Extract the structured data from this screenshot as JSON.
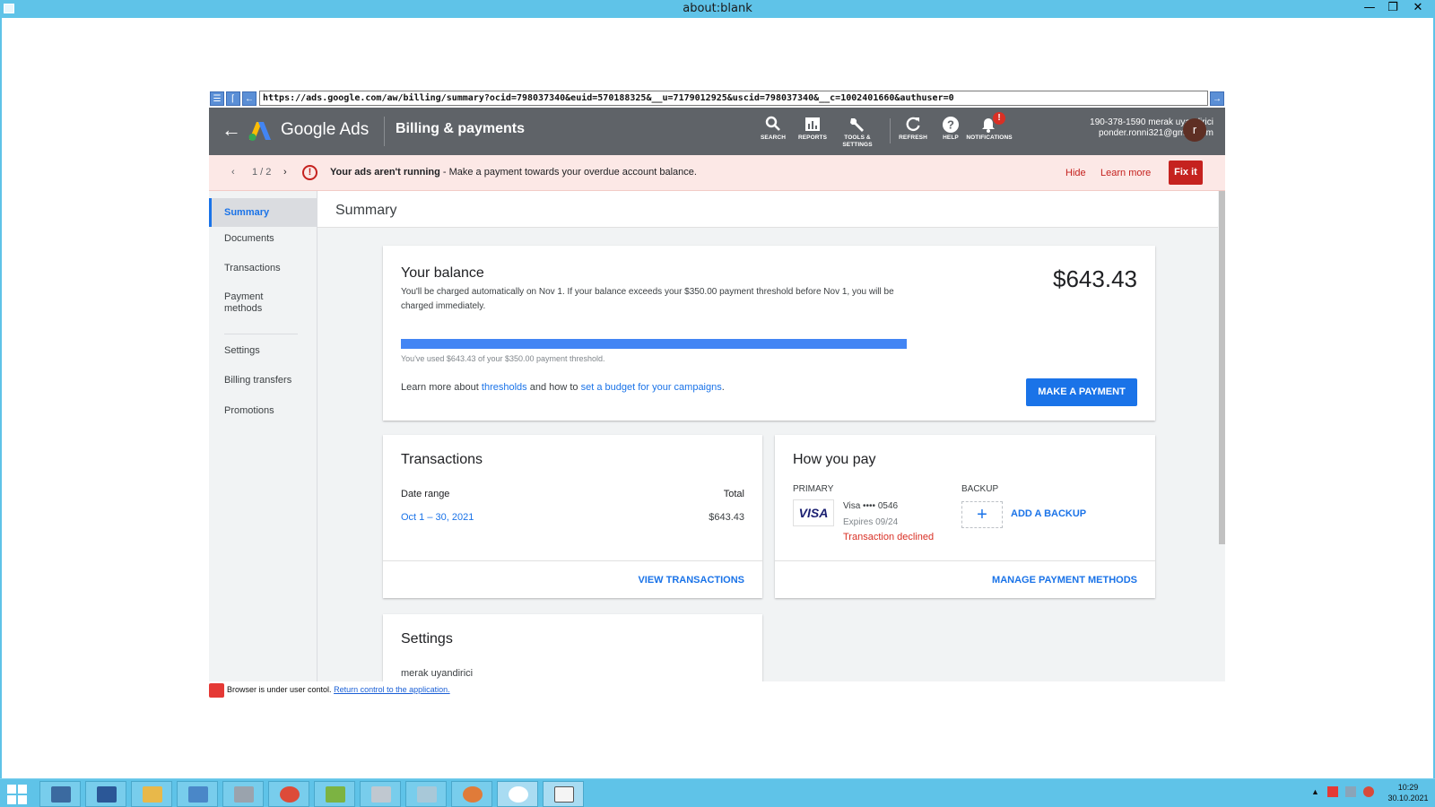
{
  "window": {
    "title": "about:blank"
  },
  "browser": {
    "url": "https://ads.google.com/aw/billing/summary?ocid=798037340&euid=570188325&__u=7179012925&uscid=798037340&__c=1002401660&authuser=0",
    "status_text": "Browser is under user contol.",
    "status_link": "Return control to the application."
  },
  "header": {
    "brand": "Google Ads",
    "page_title": "Billing & payments",
    "tools": [
      {
        "label": "SEARCH",
        "icon": "search-icon"
      },
      {
        "label": "REPORTS",
        "icon": "reports-icon"
      },
      {
        "label": "TOOLS &",
        "label2": "SETTINGS",
        "icon": "wrench-icon"
      },
      {
        "label": "REFRESH",
        "icon": "refresh-icon"
      },
      {
        "label": "HELP",
        "icon": "help-icon"
      },
      {
        "label": "NOTIFICATIONS",
        "icon": "bell-icon",
        "badge": "!"
      }
    ],
    "account_line1": "190-378-1590 merak uyandirici",
    "account_line2": "ponder.ronni321@gmail.com",
    "avatar_letter": "r"
  },
  "alert": {
    "pager": "1 / 2",
    "bold": "Your ads aren't running",
    "text": " - Make a payment towards your overdue account balance.",
    "hide": "Hide",
    "learn_more": "Learn more",
    "fix_it": "Fix it",
    "color": "#c5221f"
  },
  "sidebar": {
    "items": [
      "Summary",
      "Documents",
      "Transactions",
      "Payment methods",
      "Settings",
      "Billing transfers",
      "Promotions"
    ]
  },
  "main": {
    "heading": "Summary",
    "balance": {
      "title": "Your balance",
      "desc": "You'll be charged automatically on Nov 1. If your balance exceeds your $350.00 payment threshold before Nov 1, you will be charged immediately.",
      "amount": "$643.43",
      "progress_fraction": 1.0,
      "progress_note": "You've used $643.43 of your $350.00 payment threshold.",
      "learn_prefix": "Learn more about ",
      "thresholds": "thresholds",
      "learn_mid": " and how to ",
      "budget_link": "set a budget for your campaigns",
      "learn_suffix": ".",
      "make_payment": "MAKE A PAYMENT"
    },
    "transactions": {
      "title": "Transactions",
      "col_date": "Date range",
      "col_total": "Total",
      "date": "Oct 1 – 30, 2021",
      "total": "$643.43",
      "view": "VIEW TRANSACTIONS"
    },
    "how_you_pay": {
      "title": "How you pay",
      "primary": "PRIMARY",
      "card_brand": "VISA",
      "card_name": "Visa •••• 0546",
      "expires": "Expires 09/24",
      "declined": "Transaction declined",
      "backup": "BACKUP",
      "add_backup": "ADD A BACKUP",
      "manage": "MANAGE PAYMENT METHODS"
    },
    "settings": {
      "title": "Settings",
      "name": "merak uyandirici"
    }
  },
  "taskbar": {
    "time": "10:29",
    "date": "30.10.2021"
  },
  "colors": {
    "accent": "#1a73e8",
    "header_bg": "#5f6368",
    "progress": "#4285f4",
    "error": "#d93025"
  }
}
